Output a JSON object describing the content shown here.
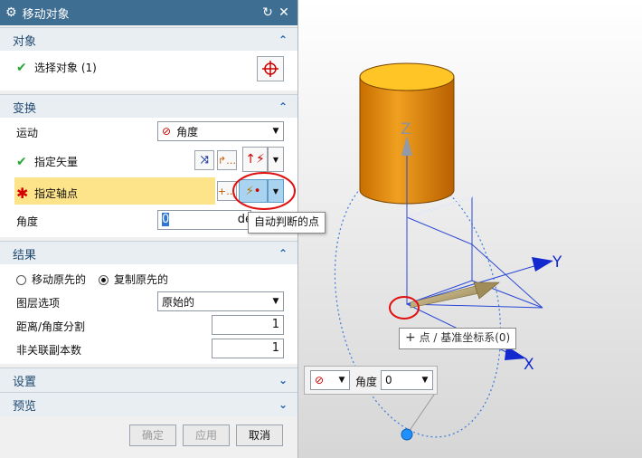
{
  "dialog": {
    "title": "移动对象",
    "sections": {
      "object": {
        "header": "对象",
        "select_label": "选择对象 (1)"
      },
      "transform": {
        "header": "变换",
        "motion_label": "运动",
        "motion_value": "角度",
        "vector_label": "指定矢量",
        "pivot_label": "指定轴点",
        "angle_label": "角度",
        "angle_value": "0",
        "angle_unit": "de"
      },
      "result": {
        "header": "结果",
        "radio_move": "移动原先的",
        "radio_copy": "复制原先的",
        "selected": "复制原先的",
        "layer_label": "图层选项",
        "layer_value": "原始的",
        "distance_label": "距离/角度分割",
        "distance_value": "1",
        "copies_label": "非关联副本数",
        "copies_value": "1"
      },
      "settings": {
        "header": "设置"
      },
      "preview": {
        "header": "预览"
      }
    },
    "buttons": {
      "ok": "确定",
      "apply": "应用",
      "cancel": "取消"
    }
  },
  "tooltip_inferred_point": "自动判断的点",
  "viewport": {
    "axis_z": "Z",
    "axis_y": "Y",
    "axis_x": "X",
    "point_tooltip": "点 / 基准坐标系(0)",
    "mini_toolbar": {
      "label": "角度",
      "value": "0"
    }
  },
  "colors": {
    "titlebar": "#3f6e93",
    "cylinder": "#e8900a",
    "axis": "#1414d2",
    "highlight": "#fde38a"
  }
}
